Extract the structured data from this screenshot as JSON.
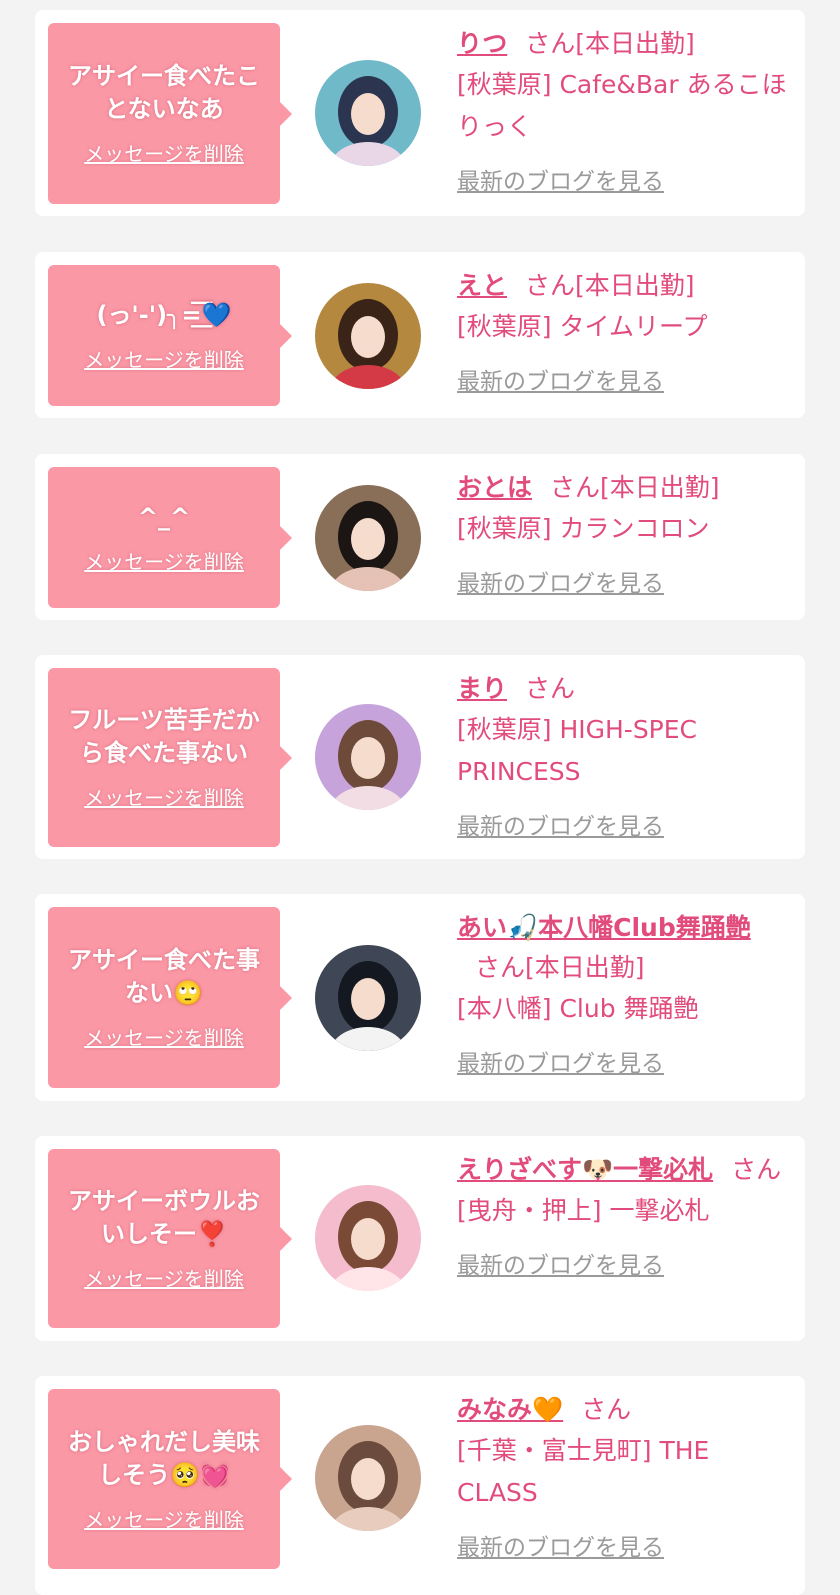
{
  "delete_label": "メッセージを削除",
  "blog_label": "最新のブログを見る",
  "san_label": "さん",
  "cards": [
    {
      "message": "アサイー食べたことないなあ",
      "name": "りつ",
      "shift": "[本日出勤]",
      "shop": "[秋葉原] Cafe&Bar あるこほりっく",
      "avatar_colors": [
        "#6fb9c9",
        "#2c3550",
        "#e9d7e7"
      ]
    },
    {
      "message": "(っ'-')╮=͟͟͞͞💙",
      "name": "えと",
      "shift": "[本日出勤]",
      "shop": "[秋葉原] タイムリープ",
      "avatar_colors": [
        "#b4883e",
        "#3a2417",
        "#d33a46"
      ]
    },
    {
      "message": "^_^",
      "name": "おとは",
      "shift": "[本日出勤]",
      "shop": "[秋葉原] カランコロン",
      "avatar_colors": [
        "#8a6f58",
        "#1b1514",
        "#e6c2b6"
      ]
    },
    {
      "message": "フルーツ苦手だから食べた事ない",
      "name": "まり",
      "shift": "",
      "shop": "[秋葉原] HIGH-SPEC PRINCESS",
      "avatar_colors": [
        "#c7a3dc",
        "#6e4a3a",
        "#f2dde4"
      ]
    },
    {
      "message": "アサイー食べた事ない🙄",
      "name": "あい🎣本八幡Club舞踊艶",
      "shift": "[本日出勤]",
      "shop": "[本八幡] Club 舞踊艶",
      "avatar_colors": [
        "#3f4656",
        "#141820",
        "#f3f3f3"
      ]
    },
    {
      "message": "アサイーボウルおいしそー❣️",
      "name": "えりざべす🐶一撃必札",
      "shift": "",
      "shop": "[曳舟・押上] 一撃必札",
      "avatar_colors": [
        "#f4bccd",
        "#7a4a37",
        "#ffe4e8"
      ]
    },
    {
      "message": "おしゃれだし美味しそう🥺💓",
      "name": "みなみ🧡",
      "shift": "",
      "shop": "[千葉・富士見町] THE CLASS",
      "avatar_colors": [
        "#c9a48f",
        "#6b4b3d",
        "#e8ccbd"
      ]
    }
  ]
}
